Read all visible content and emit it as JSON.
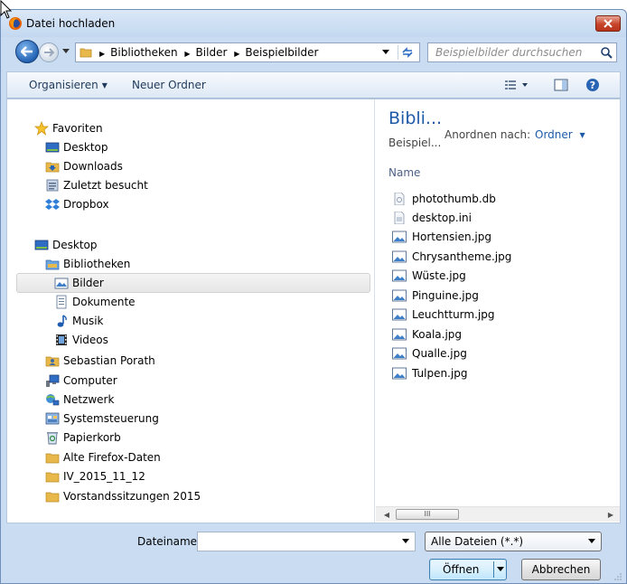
{
  "window": {
    "title": "Datei hochladen"
  },
  "address": {
    "crumbs": [
      "Bibliotheken",
      "Bilder",
      "Beispielbilder"
    ],
    "search_placeholder": "Beispielbilder durchsuchen"
  },
  "toolbar": {
    "organize_label": "Organisieren",
    "new_folder_label": "Neuer Ordner"
  },
  "nav": {
    "favorites": {
      "label": "Favoriten",
      "items": [
        "Desktop",
        "Downloads",
        "Zuletzt besucht",
        "Dropbox"
      ]
    },
    "desktop": "Desktop",
    "libraries": {
      "label": "Bibliotheken",
      "items": [
        "Bilder",
        "Dokumente",
        "Musik",
        "Videos"
      ]
    },
    "other": [
      "Sebastian Porath",
      "Computer",
      "Netzwerk",
      "Systemsteuerung",
      "Papierkorb",
      "Alte Firefox-Daten",
      "IV_2015_11_12",
      "Vorstandssitzungen 2015"
    ],
    "selected": "Bilder"
  },
  "files_pane": {
    "library_title": "Bibli...",
    "library_subtitle": "Beispiel...",
    "arrange_label": "Anordnen nach:",
    "arrange_value": "Ordner",
    "column_name": "Name",
    "files": [
      {
        "name": "photothumb.db",
        "icon": "db-file-icon"
      },
      {
        "name": "desktop.ini",
        "icon": "ini-file-icon"
      },
      {
        "name": "Hortensien.jpg",
        "icon": "image-file-icon"
      },
      {
        "name": "Chrysantheme.jpg",
        "icon": "image-file-icon"
      },
      {
        "name": "Wüste.jpg",
        "icon": "image-file-icon"
      },
      {
        "name": "Pinguine.jpg",
        "icon": "image-file-icon"
      },
      {
        "name": "Leuchtturm.jpg",
        "icon": "image-file-icon"
      },
      {
        "name": "Koala.jpg",
        "icon": "image-file-icon"
      },
      {
        "name": "Qualle.jpg",
        "icon": "image-file-icon"
      },
      {
        "name": "Tulpen.jpg",
        "icon": "image-file-icon"
      }
    ],
    "scroll_thumb_glyph": "III"
  },
  "bottom": {
    "filename_label": "Dateiname:",
    "filename_value": "",
    "filter_value": "Alle Dateien (*.*)",
    "open_label": "Öffnen",
    "cancel_label": "Abbrechen"
  },
  "colors": {
    "accent": "#1e5aa8",
    "close": "#c7452b",
    "frame": "#c9dcf2"
  }
}
